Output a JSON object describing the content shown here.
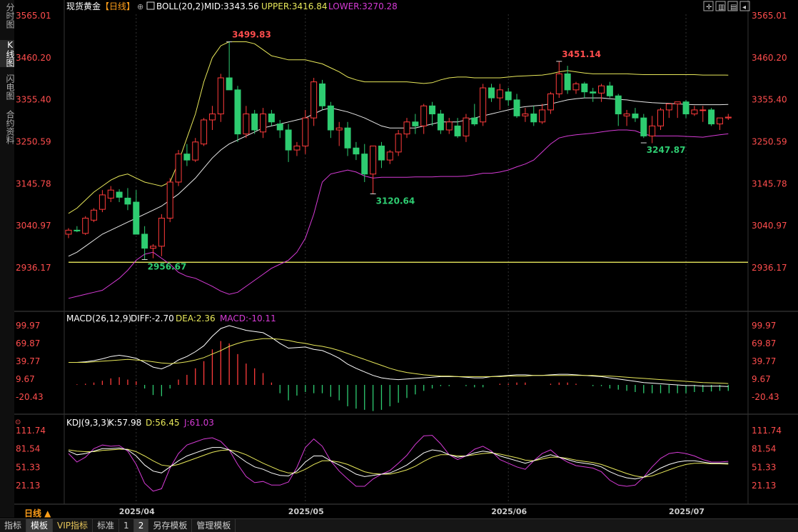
{
  "sidebar": {
    "tabs": [
      {
        "label": "分时图",
        "active": false
      },
      {
        "label": "K线图",
        "active": true
      },
      {
        "label": "闪电图",
        "active": false
      },
      {
        "label": "合约资料",
        "active": false
      }
    ]
  },
  "main_header": {
    "title": "现货黄金",
    "period": "【日线】",
    "indicator": "BOLL(20,2)",
    "mid": "MID:3343.56",
    "upper": "UPPER:3416.84",
    "lower": "LOWER:3270.28"
  },
  "macd_header": {
    "label": "MACD(26,12,9)",
    "diff": "DIFF:-2.70",
    "dea": "DEA:2.36",
    "macd": "MACD:-10.11"
  },
  "kdj_header": {
    "label": "KDJ(9,3,3)",
    "k": "K:57.98",
    "d": "D:56.45",
    "j": "J:61.03"
  },
  "period_label": "日线 ▲",
  "bottom_tabs": [
    "指标",
    "模板",
    "VIP指标",
    "标准",
    "1",
    "2",
    "另存模板",
    "管理模板"
  ],
  "bottom_active": [
    1,
    5
  ],
  "colors": {
    "up": "#ff3b3b",
    "down": "#2ecc71",
    "mid": "#e8e8e8",
    "upper": "#e8e85a",
    "lower": "#d63bd6",
    "axis_text": "#ff4d4d",
    "hline": "#ffff66",
    "kline": "#ffffff",
    "dline": "#e8e85a",
    "jline": "#d63bd6"
  },
  "chart_data": [
    {
      "type": "candlestick",
      "ylim": [
        2880,
        3580
      ],
      "yticks": [
        "3565.01",
        "3460.20",
        "3355.40",
        "3250.59",
        "3145.78",
        "3040.97",
        "2936.17"
      ],
      "xticks": [
        {
          "index": 8,
          "label": "2025/04"
        },
        {
          "index": 28,
          "label": "2025/05"
        },
        {
          "index": 52,
          "label": "2025/06"
        },
        {
          "index": 73,
          "label": "2025/07"
        }
      ],
      "hline": 2950,
      "annotations": [
        {
          "index": 19,
          "value": 3499.83,
          "label": "3499.83",
          "kind": "high"
        },
        {
          "index": 58,
          "value": 3451.14,
          "label": "3451.14",
          "kind": "high"
        },
        {
          "index": 9,
          "value": 2956.67,
          "label": "2956.67",
          "kind": "low"
        },
        {
          "index": 36,
          "value": 3120.64,
          "label": "3120.64",
          "kind": "low"
        },
        {
          "index": 68,
          "value": 3247.87,
          "label": "3247.87",
          "kind": "low"
        }
      ],
      "ohlc": [
        [
          3020,
          3035,
          3010,
          3030
        ],
        [
          3030,
          3040,
          3025,
          3028
        ],
        [
          3022,
          3065,
          3018,
          3060
        ],
        [
          3055,
          3085,
          3050,
          3080
        ],
        [
          3082,
          3130,
          3075,
          3118
        ],
        [
          3110,
          3140,
          3100,
          3130
        ],
        [
          3125,
          3132,
          3100,
          3112
        ],
        [
          3110,
          3135,
          3080,
          3095
        ],
        [
          3100,
          3130,
          3030,
          3020
        ],
        [
          3020,
          3040,
          2956,
          2985
        ],
        [
          2985,
          2995,
          2960,
          2990
        ],
        [
          2990,
          3070,
          2965,
          3060
        ],
        [
          3060,
          3160,
          3050,
          3150
        ],
        [
          3150,
          3230,
          3140,
          3220
        ],
        [
          3220,
          3245,
          3190,
          3205
        ],
        [
          3205,
          3260,
          3200,
          3250
        ],
        [
          3245,
          3310,
          3240,
          3305
        ],
        [
          3305,
          3340,
          3280,
          3320
        ],
        [
          3320,
          3420,
          3300,
          3410
        ],
        [
          3410,
          3500,
          3390,
          3380
        ],
        [
          3380,
          3390,
          3250,
          3270
        ],
        [
          3270,
          3340,
          3260,
          3320
        ],
        [
          3320,
          3330,
          3270,
          3280
        ],
        [
          3275,
          3335,
          3260,
          3320
        ],
        [
          3320,
          3330,
          3290,
          3300
        ],
        [
          3295,
          3305,
          3260,
          3280
        ],
        [
          3280,
          3295,
          3200,
          3230
        ],
        [
          3230,
          3250,
          3215,
          3240
        ],
        [
          3240,
          3330,
          3220,
          3310
        ],
        [
          3310,
          3410,
          3290,
          3400
        ],
        [
          3395,
          3405,
          3330,
          3340
        ],
        [
          3340,
          3350,
          3260,
          3280
        ],
        [
          3280,
          3300,
          3240,
          3285
        ],
        [
          3285,
          3300,
          3215,
          3235
        ],
        [
          3235,
          3250,
          3205,
          3220
        ],
        [
          3220,
          3245,
          3150,
          3170
        ],
        [
          3170,
          3230,
          3120,
          3240
        ],
        [
          3240,
          3250,
          3185,
          3205
        ],
        [
          3205,
          3230,
          3195,
          3225
        ],
        [
          3225,
          3280,
          3215,
          3270
        ],
        [
          3270,
          3310,
          3260,
          3300
        ],
        [
          3300,
          3320,
          3270,
          3290
        ],
        [
          3290,
          3345,
          3270,
          3340
        ],
        [
          3340,
          3350,
          3290,
          3320
        ],
        [
          3320,
          3330,
          3270,
          3280
        ],
        [
          3280,
          3310,
          3270,
          3300
        ],
        [
          3290,
          3310,
          3260,
          3265
        ],
        [
          3265,
          3320,
          3250,
          3310
        ],
        [
          3310,
          3345,
          3290,
          3295
        ],
        [
          3300,
          3395,
          3290,
          3385
        ],
        [
          3385,
          3395,
          3350,
          3360
        ],
        [
          3360,
          3395,
          3330,
          3380
        ],
        [
          3375,
          3385,
          3340,
          3355
        ],
        [
          3355,
          3370,
          3310,
          3315
        ],
        [
          3315,
          3335,
          3300,
          3320
        ],
        [
          3320,
          3340,
          3290,
          3300
        ],
        [
          3300,
          3345,
          3295,
          3330
        ],
        [
          3330,
          3375,
          3320,
          3370
        ],
        [
          3370,
          3451,
          3360,
          3420
        ],
        [
          3420,
          3440,
          3370,
          3380
        ],
        [
          3380,
          3400,
          3370,
          3395
        ],
        [
          3395,
          3400,
          3360,
          3375
        ],
        [
          3375,
          3385,
          3350,
          3372
        ],
        [
          3372,
          3395,
          3350,
          3390
        ],
        [
          3390,
          3400,
          3360,
          3365
        ],
        [
          3365,
          3370,
          3290,
          3320
        ],
        [
          3315,
          3330,
          3290,
          3320
        ],
        [
          3320,
          3335,
          3300,
          3310
        ],
        [
          3310,
          3320,
          3260,
          3265
        ],
        [
          3265,
          3315,
          3247,
          3290
        ],
        [
          3290,
          3335,
          3280,
          3330
        ],
        [
          3330,
          3345,
          3310,
          3345
        ],
        [
          3345,
          3350,
          3310,
          3350
        ],
        [
          3350,
          3355,
          3310,
          3320
        ],
        [
          3320,
          3340,
          3315,
          3330
        ],
        [
          3330,
          3340,
          3300,
          3330
        ],
        [
          3330,
          3335,
          3290,
          3295
        ],
        [
          3295,
          3310,
          3280,
          3310
        ],
        [
          3310,
          3320,
          3305,
          3312
        ]
      ],
      "boll_mid": [
        2965,
        2975,
        2990,
        3005,
        3020,
        3030,
        3040,
        3050,
        3060,
        3070,
        3080,
        3090,
        3105,
        3120,
        3140,
        3160,
        3185,
        3210,
        3230,
        3245,
        3255,
        3265,
        3275,
        3285,
        3290,
        3295,
        3300,
        3305,
        3310,
        3320,
        3330,
        3335,
        3330,
        3325,
        3318,
        3310,
        3300,
        3290,
        3285,
        3285,
        3285,
        3285,
        3290,
        3295,
        3300,
        3300,
        3300,
        3305,
        3310,
        3315,
        3320,
        3325,
        3330,
        3335,
        3338,
        3340,
        3342,
        3345,
        3350,
        3355,
        3358,
        3360,
        3360,
        3360,
        3358,
        3356,
        3355,
        3352,
        3350,
        3348,
        3347,
        3346,
        3345,
        3344,
        3343,
        3343,
        3343,
        3343,
        3343.56
      ],
      "boll_upper": [
        3072,
        3085,
        3105,
        3125,
        3140,
        3155,
        3165,
        3170,
        3160,
        3150,
        3145,
        3140,
        3150,
        3200,
        3260,
        3320,
        3400,
        3460,
        3490,
        3500,
        3500,
        3500,
        3495,
        3480,
        3465,
        3460,
        3455,
        3455,
        3455,
        3450,
        3445,
        3435,
        3425,
        3412,
        3405,
        3400,
        3400,
        3400,
        3400,
        3400,
        3400,
        3398,
        3396,
        3398,
        3405,
        3410,
        3412,
        3412,
        3410,
        3410,
        3410,
        3410,
        3412,
        3414,
        3415,
        3416,
        3417,
        3420,
        3425,
        3428,
        3425,
        3422,
        3420,
        3420,
        3420,
        3420,
        3420,
        3419,
        3418,
        3418,
        3418,
        3418,
        3418,
        3418,
        3418,
        3417,
        3417,
        3417,
        3416.84
      ],
      "boll_lower": [
        2860,
        2865,
        2870,
        2875,
        2880,
        2895,
        2910,
        2930,
        2955,
        2970,
        2975,
        2960,
        2945,
        2925,
        2915,
        2910,
        2900,
        2890,
        2878,
        2870,
        2875,
        2890,
        2905,
        2920,
        2935,
        2945,
        2955,
        2975,
        3010,
        3070,
        3150,
        3170,
        3175,
        3180,
        3175,
        3165,
        3160,
        3162,
        3162,
        3162,
        3162,
        3163,
        3163,
        3163,
        3164,
        3164,
        3164,
        3165,
        3168,
        3172,
        3172,
        3175,
        3180,
        3188,
        3195,
        3205,
        3225,
        3245,
        3260,
        3265,
        3268,
        3270,
        3272,
        3275,
        3278,
        3280,
        3280,
        3278,
        3270,
        3265,
        3265,
        3265,
        3265,
        3264,
        3263,
        3262,
        3265,
        3268,
        3270.28
      ]
    },
    {
      "type": "macd",
      "ylim": [
        -40,
        110
      ],
      "yticks": [
        "99.97",
        "69.87",
        "39.77",
        "9.67",
        "-20.43"
      ],
      "diff": [
        38,
        38,
        39,
        41,
        44,
        48,
        50,
        48,
        45,
        38,
        30,
        27,
        33,
        42,
        48,
        56,
        66,
        82,
        95,
        100,
        96,
        92,
        90,
        88,
        80,
        70,
        62,
        63,
        64,
        60,
        58,
        52,
        45,
        35,
        28,
        22,
        16,
        12,
        10,
        9,
        10,
        11,
        12,
        13,
        14,
        14,
        14,
        13,
        12,
        12,
        14,
        15,
        16,
        17,
        17,
        16,
        16,
        17,
        18,
        18,
        17,
        16,
        15,
        14,
        12,
        10,
        8,
        6,
        4,
        3,
        2,
        1,
        0,
        -1,
        -1,
        -2,
        -2,
        -2,
        -2.7
      ],
      "dea": [
        38,
        38,
        38,
        39,
        40,
        41,
        42,
        43,
        42,
        41,
        39,
        37,
        36,
        37,
        39,
        42,
        46,
        52,
        58,
        65,
        70,
        74,
        76,
        78,
        78,
        77,
        75,
        72,
        70,
        67,
        65,
        62,
        58,
        53,
        48,
        43,
        38,
        33,
        28,
        24,
        21,
        19,
        17,
        16,
        15,
        15,
        14,
        14,
        14,
        14,
        14,
        14,
        15,
        15,
        15,
        16,
        16,
        16,
        16,
        16,
        16,
        16,
        16,
        15,
        15,
        14,
        13,
        12,
        11,
        10,
        9,
        8,
        7,
        6,
        5,
        4,
        3.5,
        3,
        2.36
      ],
      "macd": [
        0,
        1,
        2,
        4,
        7,
        11,
        13,
        9,
        6,
        -6,
        -17,
        -19,
        -6,
        9,
        17,
        28,
        40,
        60,
        74,
        70,
        52,
        36,
        28,
        20,
        4,
        -14,
        -26,
        -18,
        -12,
        -14,
        -14,
        -20,
        -26,
        -36,
        -40,
        -42,
        -44,
        -42,
        -36,
        -30,
        -22,
        -16,
        -10,
        -6,
        -2,
        -2,
        0,
        -2,
        -4,
        -4,
        0,
        2,
        2,
        4,
        4,
        0,
        0,
        2,
        4,
        4,
        2,
        0,
        -2,
        -2,
        -6,
        -8,
        -10,
        -12,
        -14,
        -14,
        -14,
        -14,
        -14,
        -14,
        -12,
        -12,
        -11,
        -10,
        -10.11
      ]
    },
    {
      "type": "kdj",
      "ylim": [
        5,
        120
      ],
      "yticks": [
        "111.74",
        "81.54",
        "51.33",
        "21.13"
      ],
      "k": [
        78,
        72,
        74,
        78,
        82,
        82,
        83,
        80,
        70,
        55,
        45,
        42,
        52,
        62,
        70,
        75,
        80,
        84,
        84,
        80,
        70,
        60,
        52,
        48,
        42,
        38,
        37,
        45,
        60,
        70,
        70,
        62,
        55,
        48,
        40,
        36,
        38,
        40,
        42,
        48,
        55,
        65,
        75,
        80,
        78,
        72,
        68,
        70,
        75,
        78,
        76,
        70,
        66,
        62,
        58,
        62,
        68,
        72,
        68,
        64,
        60,
        58,
        56,
        52,
        44,
        38,
        34,
        32,
        35,
        42,
        50,
        56,
        60,
        62,
        62,
        60,
        58,
        58,
        57.98
      ],
      "d": [
        80,
        78,
        77,
        77,
        79,
        80,
        81,
        81,
        77,
        70,
        62,
        55,
        53,
        56,
        61,
        66,
        71,
        76,
        79,
        80,
        77,
        72,
        65,
        58,
        52,
        46,
        42,
        42,
        48,
        56,
        62,
        62,
        60,
        56,
        50,
        44,
        41,
        40,
        40,
        43,
        47,
        53,
        61,
        68,
        72,
        72,
        70,
        70,
        72,
        74,
        75,
        73,
        70,
        67,
        63,
        62,
        65,
        68,
        68,
        66,
        63,
        61,
        59,
        56,
        51,
        46,
        41,
        37,
        35,
        37,
        42,
        47,
        52,
        56,
        58,
        58,
        57,
        57,
        56.45
      ],
      "j": [
        74,
        60,
        68,
        82,
        88,
        86,
        87,
        78,
        56,
        25,
        12,
        16,
        50,
        74,
        88,
        93,
        98,
        100,
        94,
        80,
        56,
        36,
        26,
        28,
        22,
        22,
        27,
        51,
        84,
        98,
        86,
        62,
        45,
        32,
        20,
        20,
        32,
        40,
        46,
        58,
        71,
        89,
        103,
        104,
        90,
        72,
        64,
        70,
        81,
        86,
        78,
        64,
        58,
        52,
        48,
        62,
        74,
        80,
        68,
        60,
        54,
        52,
        50,
        44,
        30,
        22,
        20,
        22,
        35,
        52,
        66,
        74,
        76,
        74,
        70,
        64,
        60,
        60,
        61.03
      ]
    }
  ]
}
